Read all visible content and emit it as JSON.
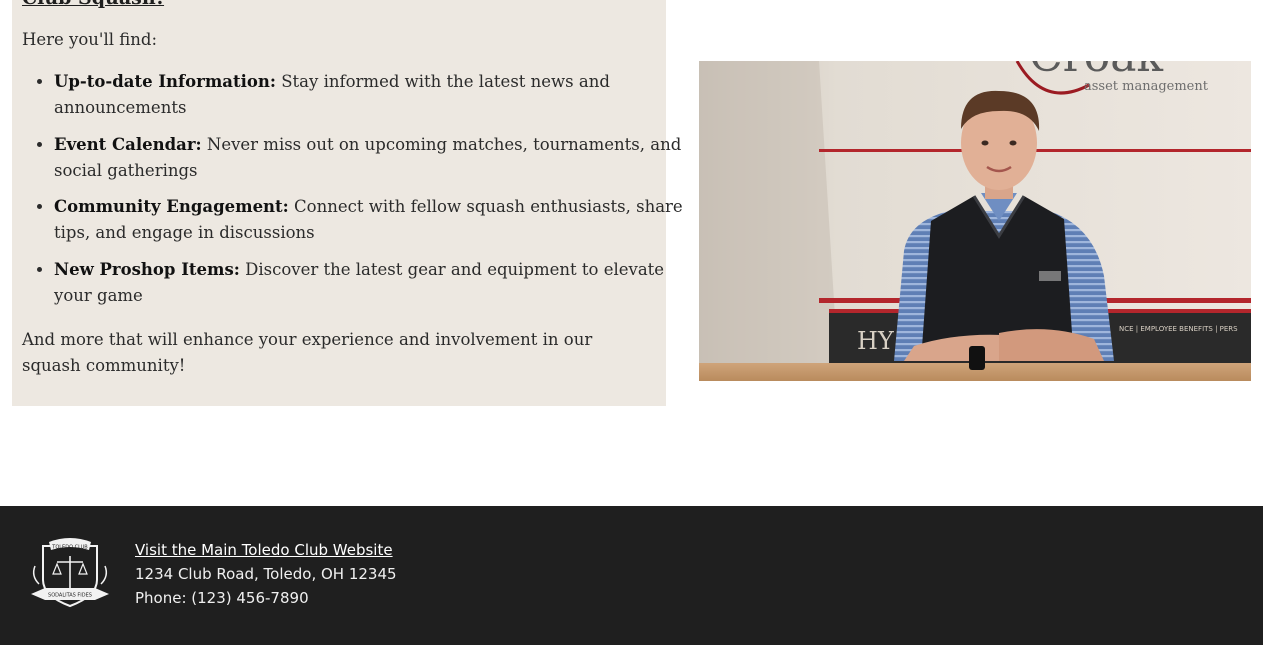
{
  "info": {
    "heading": "Club Squash!",
    "intro": "Here you'll find:",
    "features": [
      {
        "title": "Up-to-date Information:",
        "text": "Stay informed with the latest news and announcements"
      },
      {
        "title": "Event Calendar:",
        "text": "Never miss out on upcoming matches, tournaments, and social gatherings"
      },
      {
        "title": "Community Engagement:",
        "text": "Connect with fellow squash enthusiasts, share tips, and engage in discussions"
      },
      {
        "title": "New Proshop Items:",
        "text": "Discover the latest gear and equipment to elevate your game"
      }
    ],
    "closing": "And more that will enhance your experience and involvement in our squash community!"
  },
  "photo": {
    "wall_sign_partial": "Croak",
    "wall_sign_sub": "asset management",
    "banner_partial": "HY",
    "banner_right": "NCE | EMPLOYEE BENEFITS | PERS",
    "colors": {
      "court_red": "#b3262c",
      "wall": "#ebe5de",
      "floor": "#c59a6c"
    }
  },
  "footer": {
    "link_label": "Visit the Main Toledo Club Website",
    "address": "1234 Club Road, Toledo, OH 12345",
    "phone": "Phone: (123) 456-7890",
    "crest_top_text": "TOLEDO CLUB",
    "crest_banner_text": "SODALITAS FIDES",
    "colors": {
      "background": "#1f1f1f",
      "text": "#ffffff"
    }
  }
}
